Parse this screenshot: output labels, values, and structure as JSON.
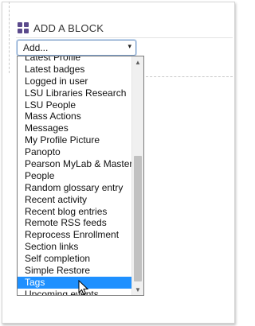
{
  "block": {
    "title": "ADD A BLOCK",
    "icon": "blocks-grid-icon",
    "icon_color": "#5b4a8c"
  },
  "select": {
    "value": "Add...",
    "arrow": "▾"
  },
  "dropdown": {
    "partial_top_item": "Latest Profile",
    "items": [
      "Latest badges",
      "Logged in user",
      "LSU Libraries Research",
      "LSU People",
      "Mass Actions",
      "Messages",
      "My Profile Picture",
      "Panopto",
      "Pearson MyLab & Mastering",
      "People",
      "Random glossary entry",
      "Recent activity",
      "Recent blog entries",
      "Remote RSS feeds",
      "Reprocess Enrollment",
      "Section links",
      "Self completion",
      "Simple Restore",
      "Tags",
      "Upcoming events"
    ],
    "selected": "Tags",
    "highlight_color": "#1e90ff"
  },
  "scrollbar": {
    "up_icon": "▲",
    "down_icon": "▼"
  }
}
